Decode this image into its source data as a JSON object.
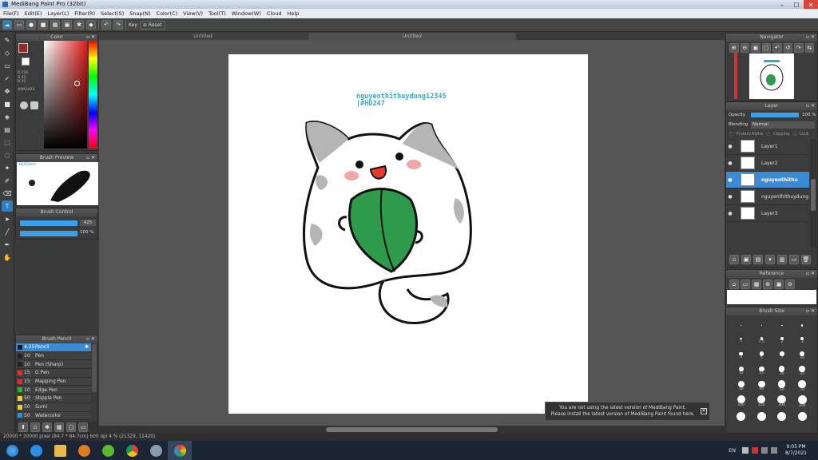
{
  "window": {
    "title": "MediBang Paint Pro (32bit)",
    "min": "–",
    "max": "☐",
    "close": "✕"
  },
  "menu": [
    "File(F)",
    "Edit(E)",
    "Layer(L)",
    "Filter(R)",
    "Select(S)",
    "Snap(N)",
    "Color(C)",
    "View(V)",
    "Tool(T)",
    "Window(W)",
    "Cloud",
    "Help"
  ],
  "toolbar": {
    "key_label": "Key",
    "reset_label": "Reset"
  },
  "tabs": [
    "Untitled",
    "Untitled"
  ],
  "color_panel": {
    "title": "Color",
    "r": "R 154",
    "g": "G 42",
    "b": "B 35",
    "hex": "#9A2A23",
    "main_color": "#9a2a23"
  },
  "brush_preview": {
    "title": "Brush Preview",
    "size": "18.03mm"
  },
  "brush_control": {
    "title": "Brush Control",
    "size_value": "425",
    "opacity_value": "100 %"
  },
  "brush_panel": {
    "title": "Brush Pencil",
    "items": [
      {
        "size": "4.25",
        "name": "Pencil",
        "color": "#1a1a1a",
        "selected": true
      },
      {
        "size": "10",
        "name": "Pen",
        "color": "#222222"
      },
      {
        "size": "10",
        "name": "Pen (Sharp)",
        "color": "#222222"
      },
      {
        "size": "15",
        "name": "G Pen",
        "color": "#e52b2b"
      },
      {
        "size": "15",
        "name": "Mapping Pen",
        "color": "#e52b2b"
      },
      {
        "size": "10",
        "name": "Edge Pen",
        "color": "#2bb52b"
      },
      {
        "size": "50",
        "name": "Stipple Pen",
        "color": "#e5d02b"
      },
      {
        "size": "50",
        "name": "Sumi",
        "color": "#e5d02b"
      },
      {
        "size": "50",
        "name": "Watercolor",
        "color": "#2b8fe5"
      }
    ]
  },
  "canvas": {
    "watermark_line1": "nguyenthithuydung12345",
    "watermark_line2": "|#HD247"
  },
  "notice": {
    "line1": "You are not using the latest version of MediBang Paint.",
    "line2": "Please install the latest version of MediBang Paint found here.",
    "close": "✕"
  },
  "navigator": {
    "title": "Navigator"
  },
  "layer_panel": {
    "title": "Layer",
    "opacity_label": "Opacity",
    "opacity_value": "100 %",
    "blending_label": "Blending",
    "blending_value": "Normal",
    "protect_alpha": "Protect Alpha",
    "clipping": "Clipping",
    "lock": "Lock",
    "layers": [
      {
        "name": "Layer1",
        "selected": false
      },
      {
        "name": "Layer2",
        "selected": false
      },
      {
        "name": "nguyenthithu",
        "selected": true
      },
      {
        "name": "nguyenthithuydung",
        "selected": false
      },
      {
        "name": "Layer3",
        "selected": false
      }
    ]
  },
  "reference": {
    "title": "Reference"
  },
  "brush_size": {
    "title": "Brush Size",
    "sizes": [
      "",
      "",
      "",
      "",
      "1",
      "1.5",
      "2",
      "3",
      "4",
      "5",
      "7",
      "10",
      "12",
      "15",
      "20",
      "25",
      "30",
      "40",
      "50",
      "70",
      "100",
      "150",
      "200",
      "300",
      "",
      "",
      "",
      ""
    ]
  },
  "status": {
    "text": "20000 * 20000 pixel  (84.7 * 84.7cm)  600 dpi  4 %  (21329, 11420)"
  },
  "taskbar": {
    "lang": "EN",
    "time": "9:05 PM",
    "date": "8/7/2021"
  }
}
